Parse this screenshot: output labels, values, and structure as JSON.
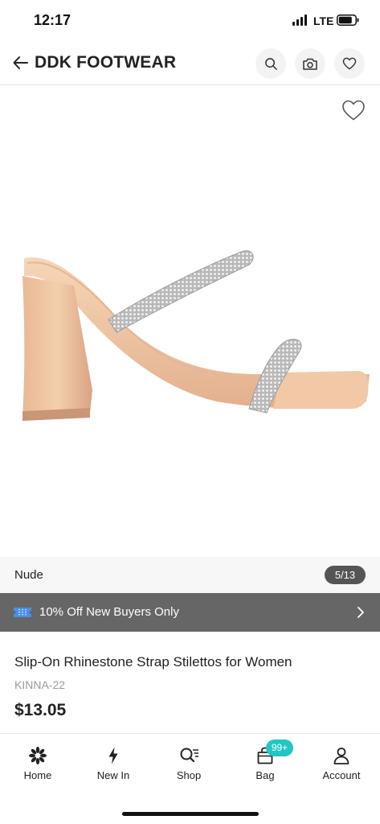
{
  "status_bar": {
    "time": "12:17",
    "network": "LTE"
  },
  "header": {
    "title": "DDK FOOTWEAR"
  },
  "gallery": {
    "image_label": "Slip-On Rhinestone Strap Stilettos for Women"
  },
  "variant": {
    "color_name": "Nude",
    "counter": "5/13"
  },
  "promo": {
    "text": "10% Off New Buyers Only"
  },
  "product": {
    "title": "Slip-On Rhinestone Strap Stilettos for Women",
    "sku": "KINNA-22",
    "price": "$13.05"
  },
  "tabs": [
    {
      "label": "Home",
      "icon": "home-flower-icon"
    },
    {
      "label": "New In",
      "icon": "lightning-icon"
    },
    {
      "label": "Shop",
      "icon": "search-list-icon"
    },
    {
      "label": "Bag",
      "icon": "bag-icon",
      "badge": "99+"
    },
    {
      "label": "Account",
      "icon": "person-icon"
    }
  ],
  "colors": {
    "promo_bg": "#666666",
    "badge": "#22c7c2",
    "counter_bg": "#555555"
  }
}
